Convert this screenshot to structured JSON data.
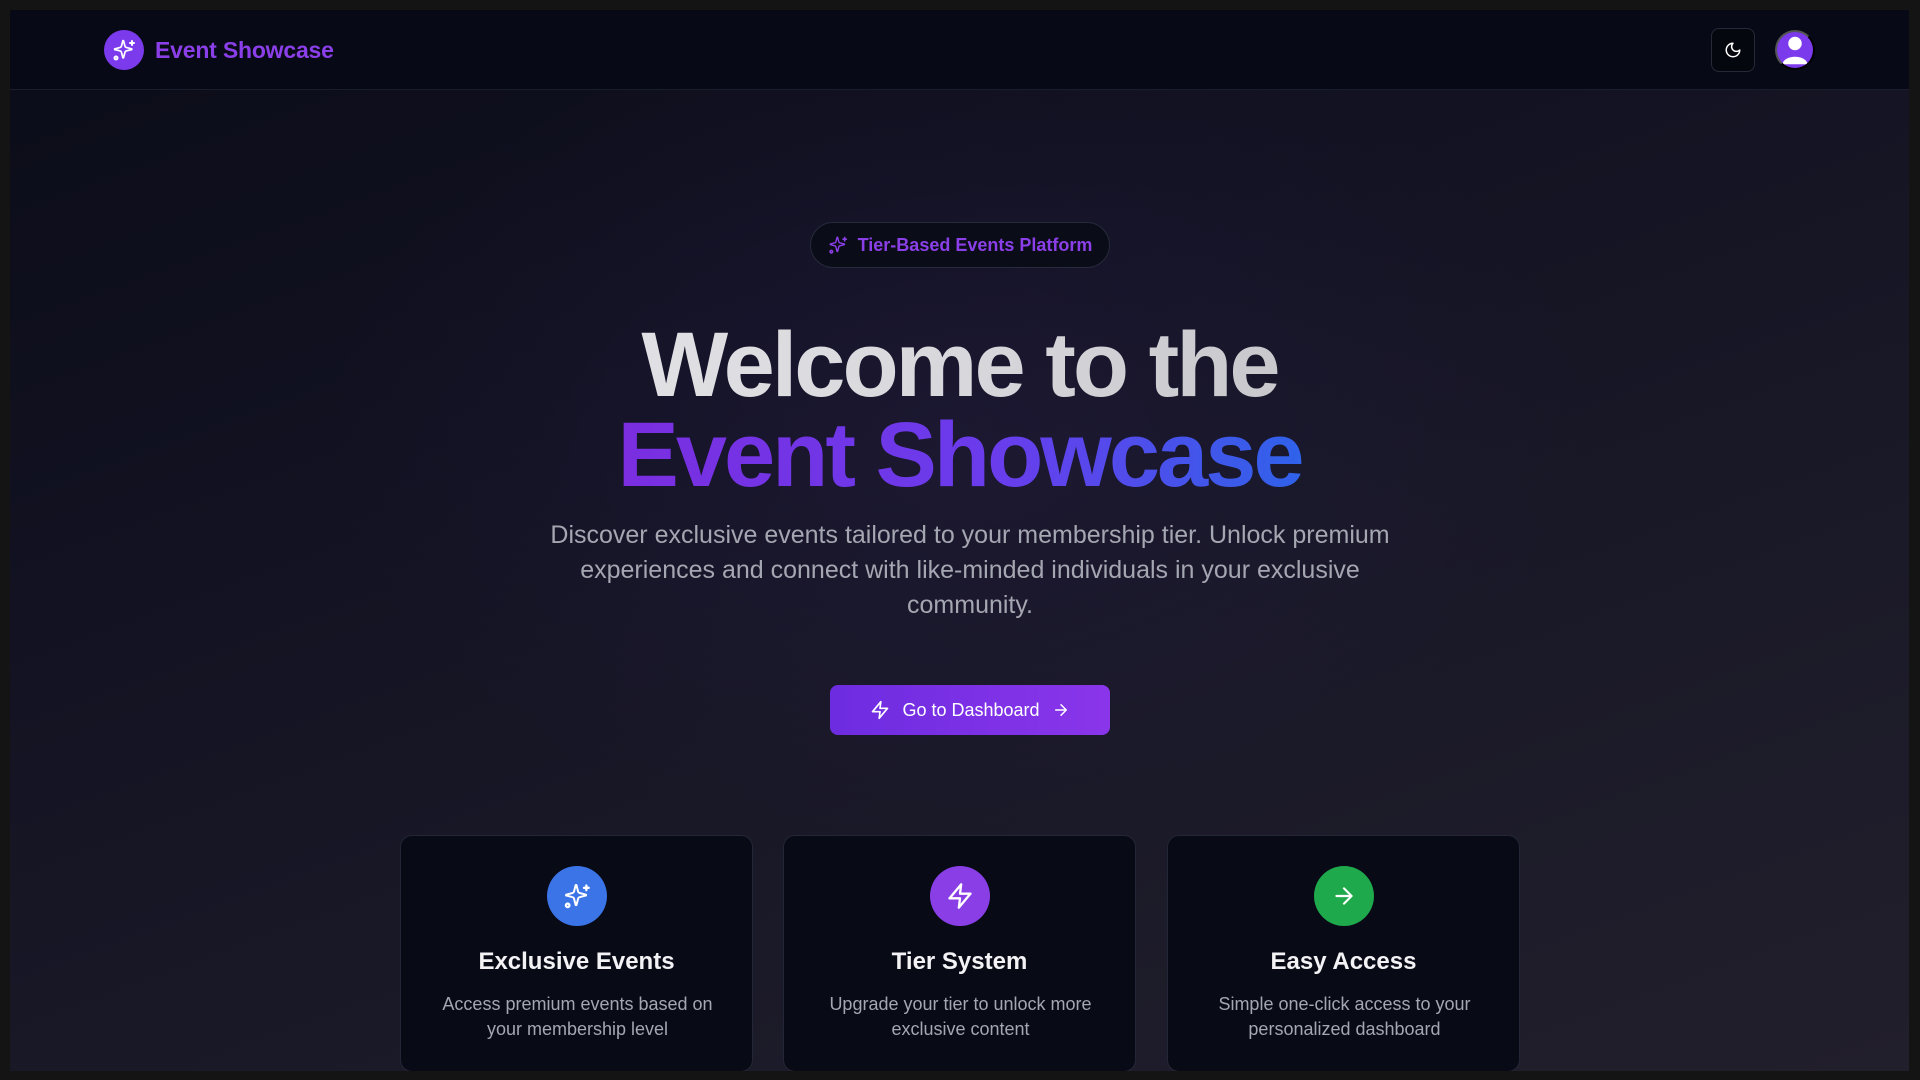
{
  "header": {
    "brand_name": "Event Showcase",
    "brand_icon": "sparkles-icon",
    "theme_toggle_icon": "moon-icon",
    "avatar_icon": "user-icon",
    "accent_color": "#7c3aed"
  },
  "hero": {
    "badge_label": "Tier-Based Events Platform",
    "badge_icon": "sparkles-icon",
    "title_line1": "Welcome to the",
    "title_line2": "Event Showcase",
    "description": "Discover exclusive events tailored to your membership tier. Unlock premium experiences and connect with like-minded individuals in your exclusive community.",
    "cta_label": "Go to Dashboard",
    "cta_icon_left": "zap-icon",
    "cta_icon_right": "arrow-right-icon"
  },
  "features": [
    {
      "title": "Exclusive Events",
      "description": "Access premium events based on your membership level",
      "icon": "sparkles-icon",
      "color": "#3b74e6"
    },
    {
      "title": "Tier System",
      "description": "Upgrade your tier to unlock more exclusive content",
      "icon": "zap-icon",
      "color": "#8a3fe6"
    },
    {
      "title": "Easy Access",
      "description": "Simple one-click access to your personalized dashboard",
      "icon": "arrow-right-icon",
      "color": "#1fa94d"
    }
  ]
}
